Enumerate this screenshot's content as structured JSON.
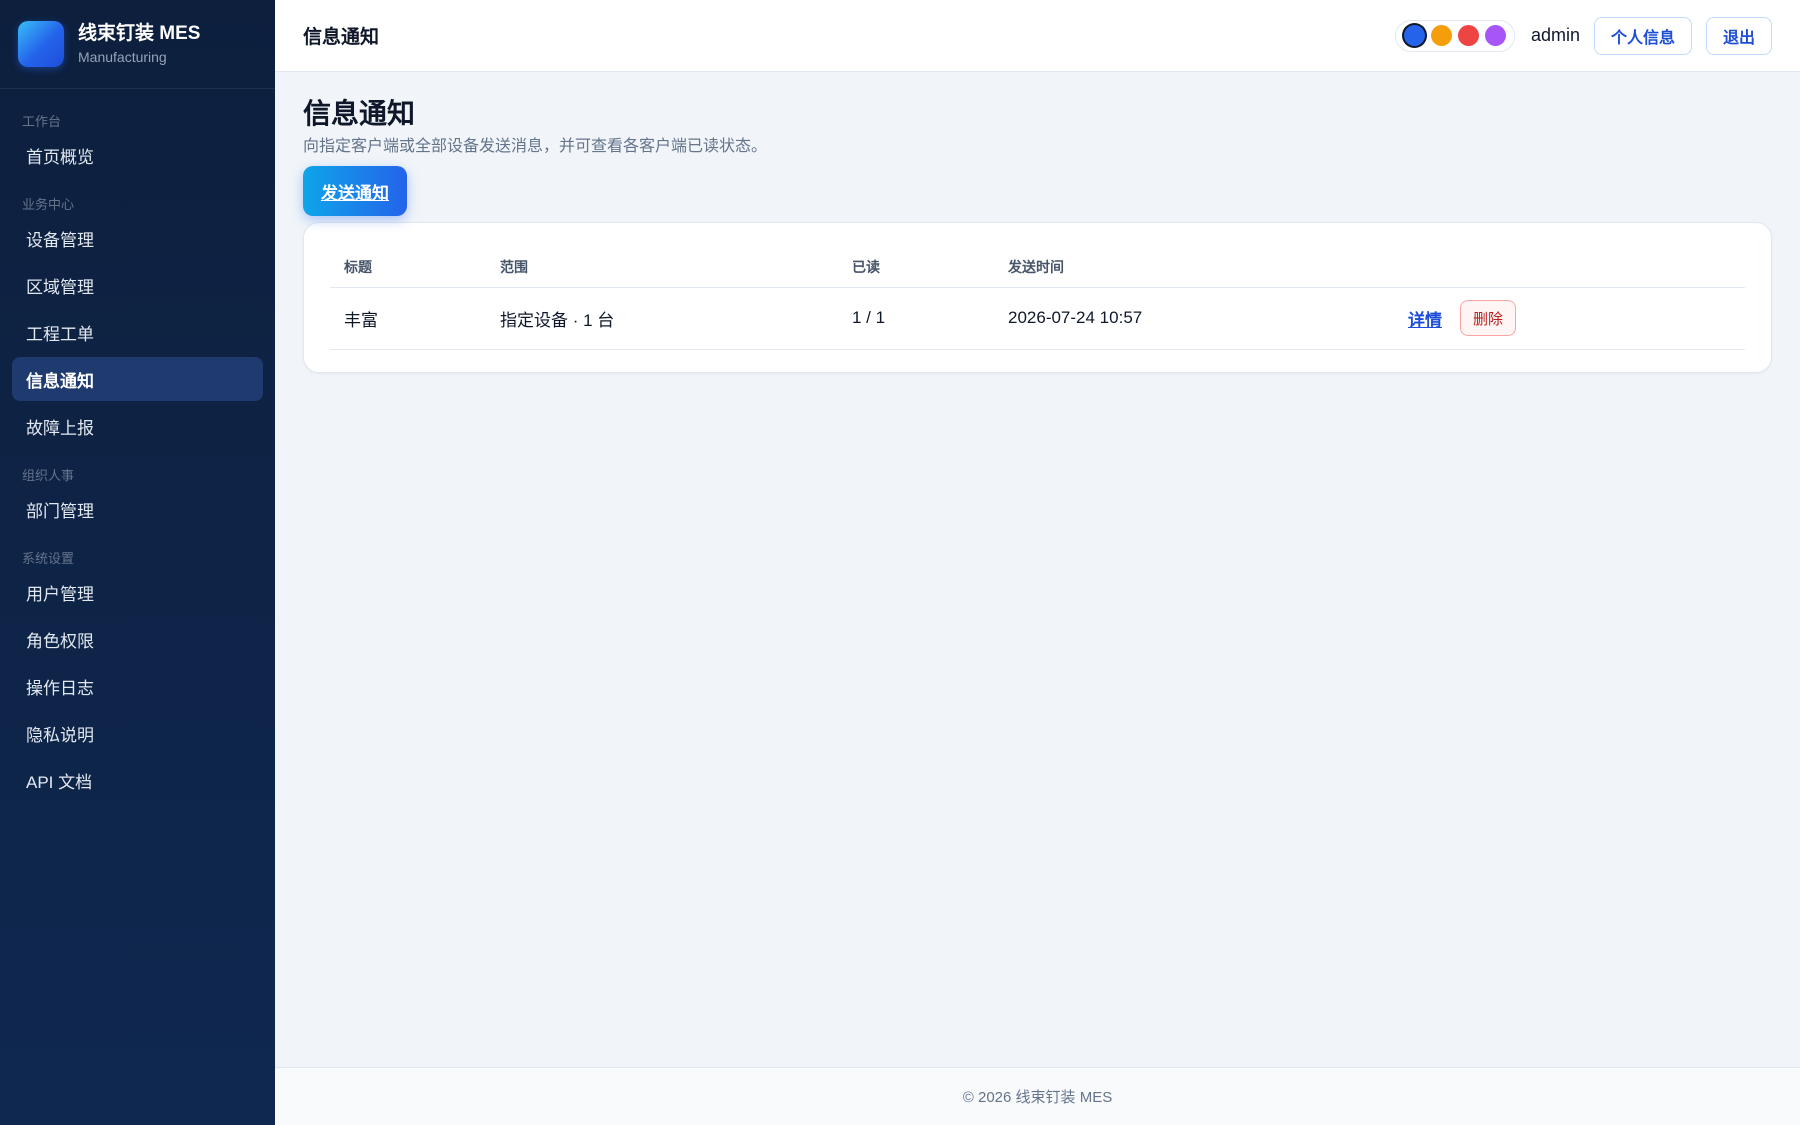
{
  "brand": {
    "title": "线束钉装 MES",
    "subtitle": "Manufacturing"
  },
  "sidebar": {
    "sections": [
      {
        "label": "工作台",
        "items": [
          {
            "label": "首页概览"
          }
        ]
      },
      {
        "label": "业务中心",
        "items": [
          {
            "label": "设备管理"
          },
          {
            "label": "区域管理"
          },
          {
            "label": "工程工单"
          },
          {
            "label": "信息通知",
            "active": true
          },
          {
            "label": "故障上报"
          }
        ]
      },
      {
        "label": "组织人事",
        "items": [
          {
            "label": "部门管理"
          }
        ]
      },
      {
        "label": "系统设置",
        "items": [
          {
            "label": "用户管理"
          },
          {
            "label": "角色权限"
          },
          {
            "label": "操作日志"
          },
          {
            "label": "隐私说明"
          },
          {
            "label": "API 文档"
          }
        ]
      }
    ]
  },
  "header": {
    "title": "信息通知",
    "theme_colors": [
      "#2563eb",
      "#f59e0b",
      "#ef4444",
      "#a855f7"
    ],
    "user": "admin",
    "profile_label": "个人信息",
    "logout_label": "退出"
  },
  "main": {
    "title": "信息通知",
    "description": "向指定客户端或全部设备发送消息，并可查看各客户端已读状态。",
    "send_button": "发送通知",
    "table": {
      "columns": [
        "标题",
        "范围",
        "已读",
        "发送时间",
        ""
      ],
      "rows": [
        {
          "title": "丰富",
          "scope": "指定设备 · 1 台",
          "read": "1 / 1",
          "sent_at": "2026-07-24 10:57",
          "detail_label": "详情",
          "delete_label": "删除"
        }
      ]
    }
  },
  "footer": {
    "text": "© 2026 线束钉装 MES"
  }
}
